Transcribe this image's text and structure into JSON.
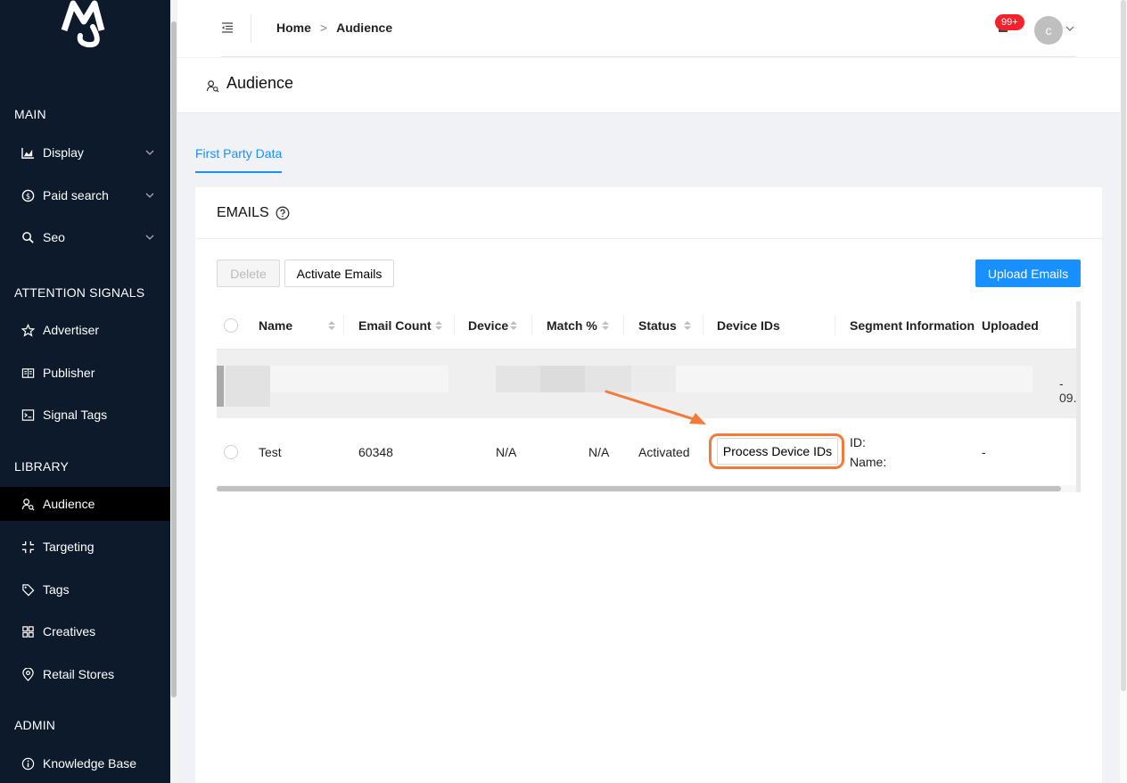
{
  "sidebar": {
    "sections": {
      "main": "MAIN",
      "attention": "ATTENTION SIGNALS",
      "library": "LIBRARY",
      "admin": "ADMIN"
    },
    "items": [
      {
        "label": "Display",
        "icon": "area-chart-icon"
      },
      {
        "label": "Paid search",
        "icon": "dollar-icon"
      },
      {
        "label": "Seo",
        "icon": "search-icon"
      },
      {
        "label": "Advertiser",
        "icon": "star-icon"
      },
      {
        "label": "Publisher",
        "icon": "book-icon"
      },
      {
        "label": "Signal Tags",
        "icon": "terminal-icon"
      },
      {
        "label": "Audience",
        "icon": "audience-icon"
      },
      {
        "label": "Targeting",
        "icon": "compress-icon"
      },
      {
        "label": "Tags",
        "icon": "tag-icon"
      },
      {
        "label": "Creatives",
        "icon": "appstore-icon"
      },
      {
        "label": "Retail Stores",
        "icon": "location-icon"
      },
      {
        "label": "Knowledge Base",
        "icon": "info-icon"
      }
    ]
  },
  "header": {
    "breadcrumb": {
      "home": "Home",
      "separator": ">",
      "current": "Audience"
    },
    "notification_badge": "99+",
    "avatar_letter": "c"
  },
  "page": {
    "title": "Audience",
    "tab": "First Party Data"
  },
  "card": {
    "title": "EMAILS",
    "buttons": {
      "delete": "Delete",
      "activate": "Activate Emails",
      "upload": "Upload Emails"
    }
  },
  "table": {
    "columns": [
      "Name",
      "Email Count",
      "Device",
      "Match %",
      "Status",
      "Device IDs",
      "Segment Information",
      "Uploaded"
    ],
    "blurred_row": {
      "uploaded_text": "- 09.."
    },
    "rows": [
      {
        "name": "Test",
        "email_count": "60348",
        "device": "N/A",
        "match": "N/A",
        "status": "Activated",
        "device_ids_button": "Process Device IDs",
        "segment_id_label": "ID:",
        "segment_name_label": "Name:",
        "uploaded": "-"
      }
    ]
  },
  "colors": {
    "sidebar_bg": "#0c1a2c",
    "accent": "#1890ff",
    "highlight": "#f47a3c",
    "badge": "#f5222d"
  }
}
